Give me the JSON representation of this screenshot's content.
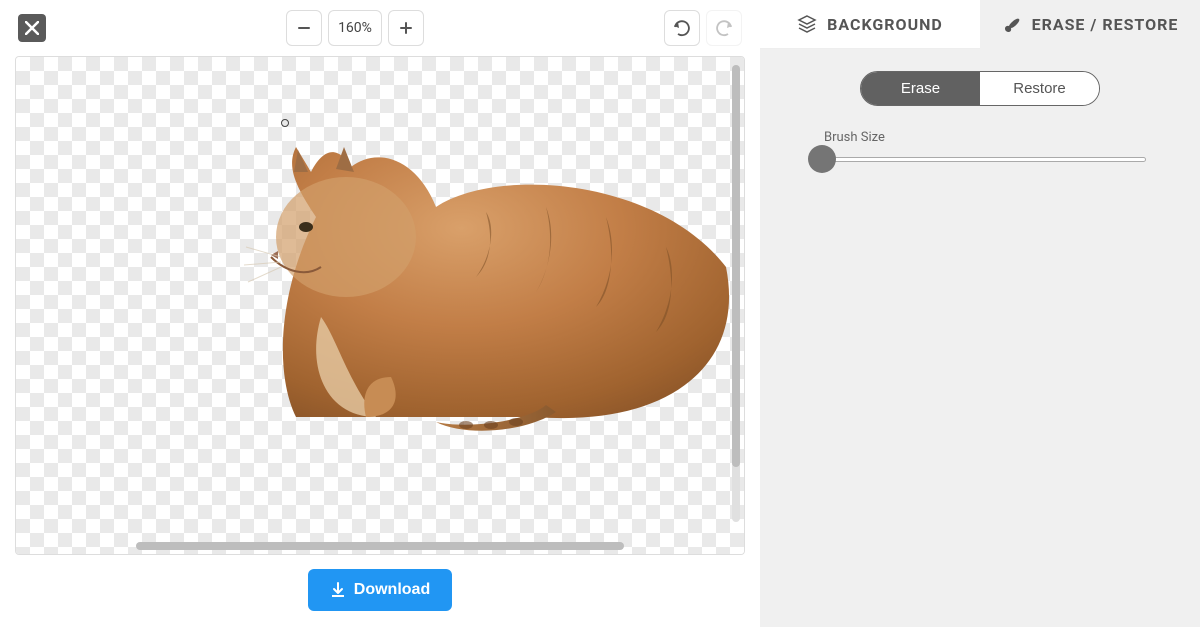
{
  "toolbar": {
    "zoom_level": "160%"
  },
  "download": {
    "label": "Download"
  },
  "tabs": {
    "background": {
      "label": "BACKGROUND",
      "active": true
    },
    "erase_restore": {
      "label": "ERASE / RESTORE",
      "active": false
    }
  },
  "erase_restore_panel": {
    "toggle": {
      "erase_label": "Erase",
      "restore_label": "Restore",
      "active": "erase"
    },
    "brush_size_label": "Brush Size",
    "brush_size_value": 5
  },
  "canvas": {
    "subject": "cat"
  }
}
